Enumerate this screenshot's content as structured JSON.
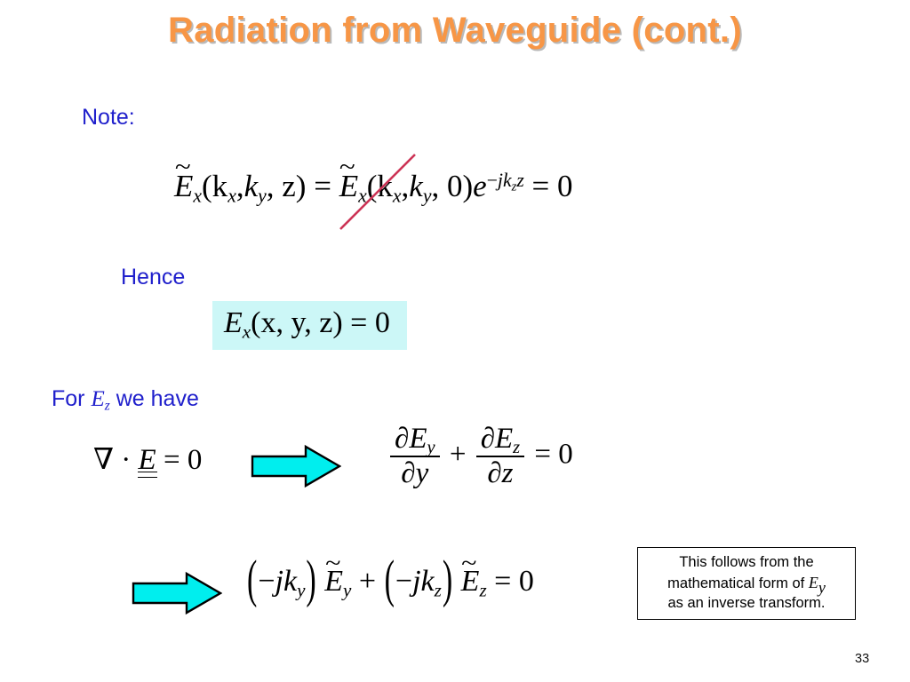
{
  "slide": {
    "title": "Radiation from Waveguide (cont.)",
    "title_color": "#F79646",
    "title_shadow_color": "#b9b9b9",
    "background": "#ffffff",
    "page_number": "33"
  },
  "labels": {
    "note": "Note:",
    "hence": "Hence",
    "for_ez_prefix": "For ",
    "for_ez_symbol": "E",
    "for_ez_subscript": "z",
    "for_ez_suffix": " we have",
    "label_color": "#2020CC"
  },
  "equations": {
    "fourier": {
      "name": "spectral-field-propagation",
      "plain": "Ẽx(kx, ky, z) = Ẽx(kx, ky, 0) e^(−j kz z) = 0",
      "lhs_E": "E",
      "lhs_sub": "x",
      "args1": "(k",
      "sub_x": "x",
      "comma": ",",
      "k2": "k",
      "sub_y": "y",
      "z_arg": ", z)",
      "equals": " = ",
      "rhs_args": "(k",
      "rhs_zero": ", 0)",
      "exp_base": "e",
      "exp_sign": "−",
      "exp_j": "j",
      "exp_k": "k",
      "exp_ksub": "z",
      "exp_z": "z",
      "result": " = 0",
      "struck": true,
      "strike_color": "#CC3355"
    },
    "ex_zero": {
      "name": "ex-vanishes",
      "plain": "Ex(x, y, z) = 0",
      "E": "E",
      "sub": "x",
      "args": "(x, y, z)",
      "equals": " = 0",
      "highlight_color": "#CCF7F7"
    },
    "divergence": {
      "name": "divergence-of-E",
      "plain": "∇ · E = 0",
      "nabla": "∇",
      "dot": " · ",
      "E": "E",
      "equals": " = 0"
    },
    "divergence_expanded": {
      "name": "divergence-expanded",
      "plain": "∂Ey/∂y + ∂Ez/∂z = 0",
      "partial": "∂",
      "E": "E",
      "sub_y": "y",
      "sub_z": "z",
      "den_y": "y",
      "den_z": "z",
      "plus": " + ",
      "equals": " = 0"
    },
    "spectral": {
      "name": "spectral-divergence",
      "plain": "(−jky) Ẽy + (−jkz) Ẽz = 0",
      "open_paren": "(",
      "close_paren": ")",
      "minus": "−",
      "j": "j",
      "k": "k",
      "sub_y": "y",
      "sub_z": "z",
      "E": "E",
      "plus": " + ",
      "equals": " = 0"
    }
  },
  "arrows": {
    "fill_color": "#00EEEE",
    "stroke_color": "#000000",
    "arrow_1_name": "implication-arrow-1",
    "arrow_2_name": "implication-arrow-2"
  },
  "callout": {
    "name": "explanatory-note",
    "line1": "This follows from the",
    "line2_prefix": "mathematical form of ",
    "line2_symbol": "E",
    "line2_subscript": "y",
    "line3": "as an inverse transform.",
    "border_color": "#000000"
  }
}
